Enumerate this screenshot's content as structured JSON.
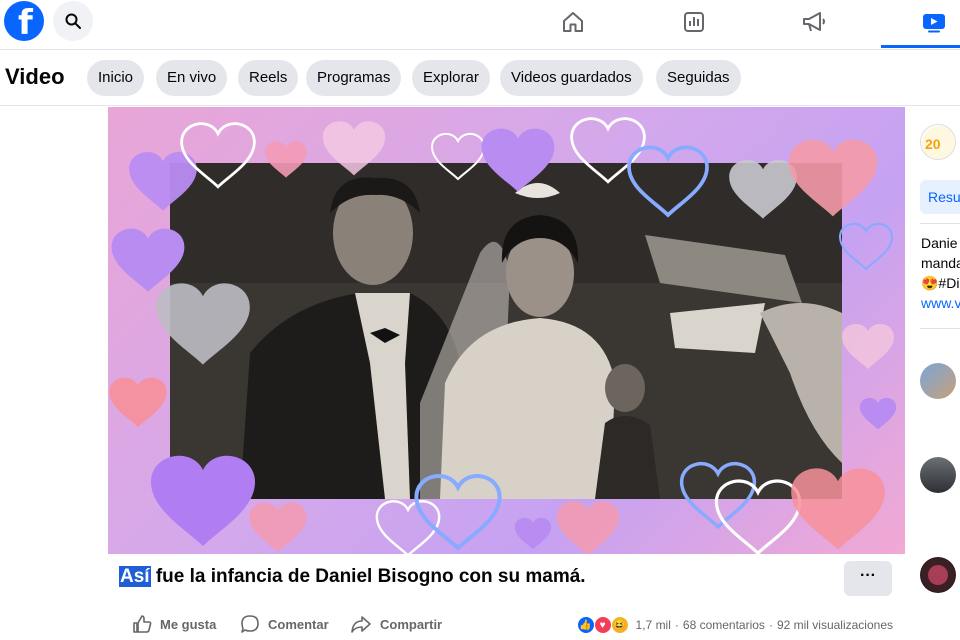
{
  "top_nav": {
    "logo_letter": "f",
    "icons": [
      "home-icon",
      "bar-chart-icon",
      "megaphone-icon",
      "video-icon"
    ],
    "active_icon": "video-icon",
    "brand_color": "#0866ff"
  },
  "video_header": {
    "title": "Video",
    "tabs": [
      "Inicio",
      "En vivo",
      "Reels",
      "Programas",
      "Explorar",
      "Videos guardados",
      "Seguidas"
    ]
  },
  "post": {
    "caption_highlight": "Así",
    "caption_rest": " fue la infancia de Daniel Bisogno con su mamá.",
    "more_label": "···",
    "actions": {
      "like": "Me gusta",
      "comment": "Comentar",
      "share": "Compartir"
    },
    "stats": {
      "reactions": "1,7 mil",
      "reaction_icons": [
        "like-reaction-icon",
        "love-reaction-icon",
        "haha-reaction-icon"
      ],
      "comments": "68 comentarios",
      "separator": "·",
      "views": "92 mil visualizaciones"
    }
  },
  "sidebar": {
    "page_button": "Resu",
    "desc_line1": "Danie",
    "desc_line2": "manda",
    "desc_line3": "😍#Di",
    "desc_link": "www.v"
  }
}
